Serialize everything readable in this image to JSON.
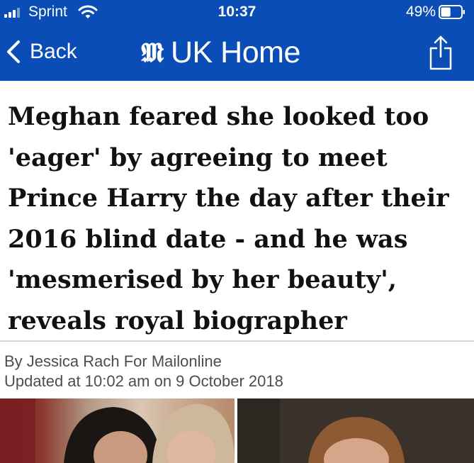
{
  "status_bar": {
    "carrier": "Sprint",
    "time": "10:37",
    "battery_percent": "49%",
    "battery_level": 0.49,
    "icons": [
      "signal-icon",
      "wifi-icon",
      "battery-icon"
    ]
  },
  "nav": {
    "back_label": "Back",
    "logo_text": "M",
    "section_title": "UK Home",
    "share_icon": "share-icon",
    "back_icon": "chevron-left-icon"
  },
  "colors": {
    "brand_blue": "#0b4db6",
    "headline": "#111111",
    "meta_text": "#4d4d4d"
  },
  "article": {
    "headline": "Meghan feared she looked too 'eager' by agreeing to meet Prince Harry the day after their 2016 blind date - and he was 'mesmerised by her beauty', reveals royal biographer",
    "byline": "By Jessica Rach For Mailonline",
    "updated": "Updated at 10:02 am on 9 October 2018"
  }
}
